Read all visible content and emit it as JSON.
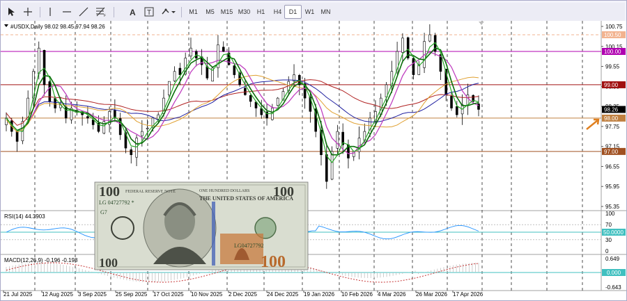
{
  "toolbar": {
    "tools": [
      "cursor-tool",
      "crosshair-tool",
      "vertical-line-tool",
      "horizontal-line-tool",
      "trendline-tool",
      "fibonacci-tool",
      "text-tool",
      "text-label-tool",
      "shapes-tool"
    ],
    "timeframes": [
      "M1",
      "M5",
      "M15",
      "M30",
      "H1",
      "H4",
      "D1",
      "W1",
      "MN"
    ],
    "active_timeframe": "D1"
  },
  "main": {
    "title": "#USDX,Daily  98.02 98.45 97.94 98.26",
    "price_labels": [
      "100.75",
      "100.15",
      "99.55",
      "98.95",
      "98.35",
      "97.75",
      "97.15",
      "96.55",
      "95.95",
      "95.35"
    ],
    "levels": [
      {
        "value": "100.50",
        "color": "#f2b38f",
        "style": "dashed"
      },
      {
        "value": "100.00",
        "color": "#b000b0",
        "style": "solid"
      },
      {
        "value": "99.00",
        "color": "#a01010",
        "style": "solid"
      },
      {
        "value": "98.00",
        "color": "#c08040",
        "style": "solid"
      },
      {
        "value": "97.00",
        "color": "#a05020",
        "style": "solid"
      }
    ],
    "current_price": "98.26",
    "candle_color": "#000000",
    "ma_colors": {
      "fast": "#28a828",
      "fast2": "#0a6e0a",
      "mid": "#c040c0",
      "slow": "#e0a030",
      "slow2": "#2020a0",
      "slowest": "#b02020"
    }
  },
  "rsi": {
    "title": "RSI(14) 44.3903",
    "labels": [
      "100",
      "70",
      "30",
      "0"
    ],
    "level_tag": "50.0000",
    "line_color": "#1e90ff"
  },
  "macd": {
    "title": "MACD(12,26,9) -0.196 -0.198",
    "labels": [
      "0.649",
      "-0.643"
    ],
    "zero_tag": "0.000"
  },
  "dates": [
    "21 Jul 2025",
    "12 Aug 2025",
    "3 Sep 2025",
    "25 Sep 2025",
    "17 Oct 2025",
    "10 Nov 2025",
    "2 Dec 2025",
    "24 Dec 2025",
    "19 Jan 2026",
    "10 Feb 2026",
    "4 Mar 2026",
    "26 Mar 2026",
    "17 Apr 2026"
  ],
  "banknote": {
    "denomination": "100",
    "serial": "LG 04727792 *",
    "serial_short": "LG04727792",
    "block": "G7",
    "header_lines": [
      "FEDERAL RESERVE NOTE",
      "THE UNITED STATES OF AMERICA",
      "ONE HUNDRED DOLLARS"
    ]
  }
}
